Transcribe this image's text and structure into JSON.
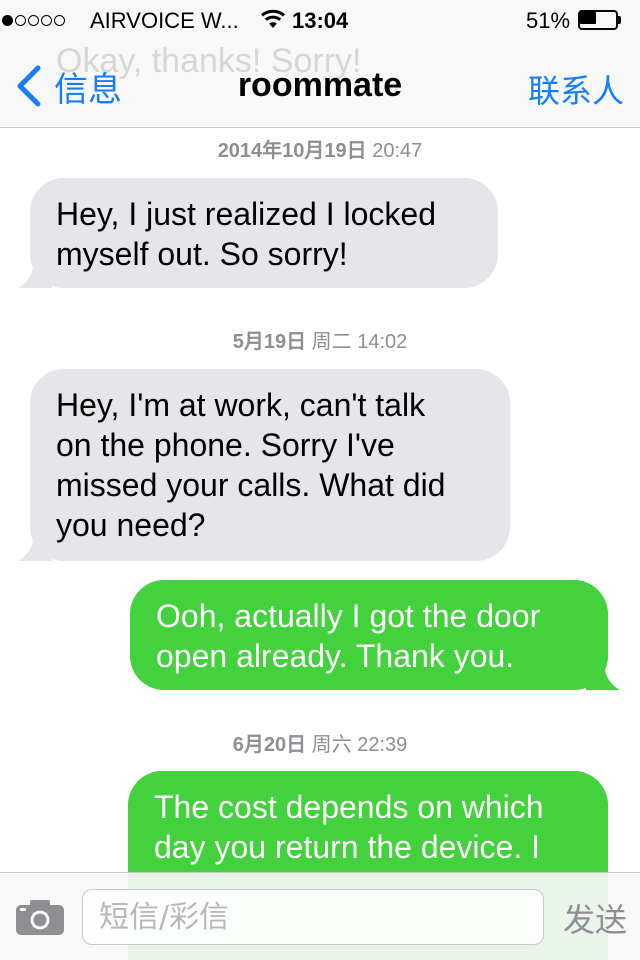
{
  "status_bar": {
    "carrier": "AIRVOICE W...",
    "time": "13:04",
    "battery_percent": "51%",
    "battery_level": 0.51,
    "signal_strength": 1,
    "signal_max": 5
  },
  "nav": {
    "back_label": "信息",
    "title": "roommate",
    "contact_label": "联系人",
    "ghost_text": "Okay, thanks! Sorry!"
  },
  "conversation": {
    "timestamps": [
      {
        "bold": "2014年10月19日",
        "normal": "20:47"
      },
      {
        "bold": "5月19日",
        "normal": "周二 14:02"
      },
      {
        "bold": "6月20日",
        "normal": "周六 22:39"
      }
    ],
    "messages": [
      {
        "direction": "incoming",
        "text": "Hey, I just realized I locked\nmyself out. So sorry!"
      },
      {
        "direction": "incoming",
        "text": "Hey, I'm at work, can't talk\non the phone. Sorry I've\nmissed your calls. What did\nyou need?"
      },
      {
        "direction": "outgoing",
        "text": "Ooh, actually I got the door\nopen already. Thank you."
      },
      {
        "direction": "outgoing",
        "text": "The cost depends on which\nday you return the device. I"
      }
    ]
  },
  "composer": {
    "placeholder": "短信/彩信",
    "send_label": "发送",
    "camera_icon": "camera-icon"
  },
  "colors": {
    "accent": "#147efb",
    "incoming_bubble": "#e5e5ea",
    "outgoing_bubble": "#43d13d",
    "timestamp_text": "#8e8e93"
  }
}
